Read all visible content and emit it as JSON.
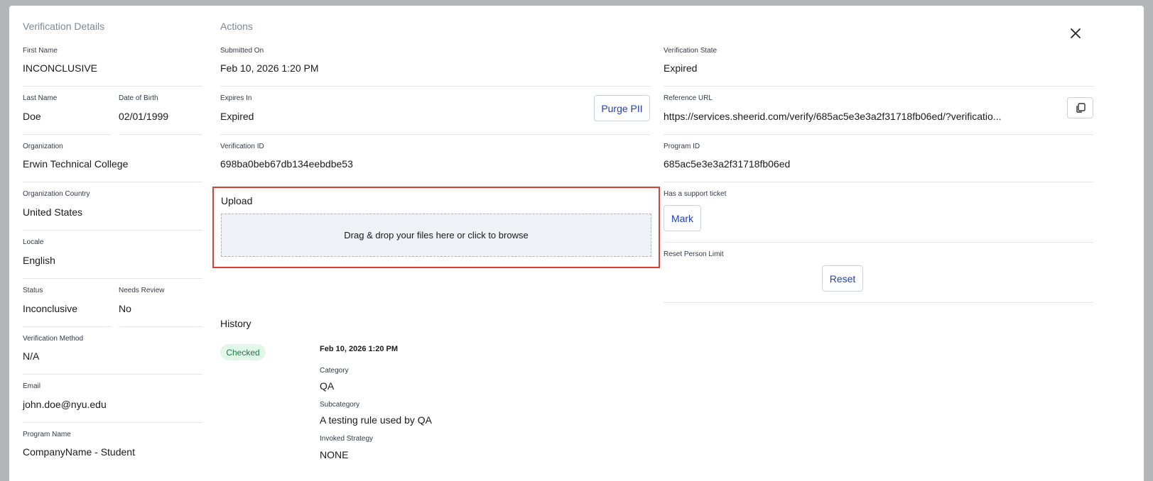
{
  "details": {
    "title": "Verification Details",
    "first_name": {
      "label": "First Name",
      "value": "INCONCLUSIVE"
    },
    "last_name": {
      "label": "Last Name",
      "value": "Doe"
    },
    "dob": {
      "label": "Date of Birth",
      "value": "02/01/1999"
    },
    "organization": {
      "label": "Organization",
      "value": "Erwin Technical College"
    },
    "org_country": {
      "label": "Organization Country",
      "value": "United States"
    },
    "locale": {
      "label": "Locale",
      "value": "English"
    },
    "status": {
      "label": "Status",
      "value": "Inconclusive"
    },
    "needs_review": {
      "label": "Needs Review",
      "value": "No"
    },
    "method": {
      "label": "Verification Method",
      "value": "N/A"
    },
    "email": {
      "label": "Email",
      "value": "john.doe@nyu.edu"
    },
    "program_name": {
      "label": "Program Name",
      "value": "CompanyName - Student"
    }
  },
  "actions": {
    "title": "Actions",
    "submitted_on": {
      "label": "Submitted On",
      "value": "Feb 10, 2026 1:20 PM"
    },
    "expires_in": {
      "label": "Expires In",
      "value": "Expired"
    },
    "purge_button": "Purge PII",
    "verification_id": {
      "label": "Verification ID",
      "value": "698ba0beb67db134eebdbe53"
    },
    "upload": {
      "title": "Upload",
      "dropzone_text": "Drag & drop your files here or click to browse"
    }
  },
  "right": {
    "state": {
      "label": "Verification State",
      "value": "Expired"
    },
    "reference_url": {
      "label": "Reference URL",
      "value": "https://services.sheerid.com/verify/685ac5e3e3a2f31718fb06ed/?verificatio..."
    },
    "program_id": {
      "label": "Program ID",
      "value": "685ac5e3e3a2f31718fb06ed"
    },
    "support_ticket": {
      "label": "Has a support ticket",
      "button": "Mark"
    },
    "reset_limit": {
      "label": "Reset Person Limit",
      "button": "Reset"
    }
  },
  "history": {
    "title": "History",
    "entries": [
      {
        "badge": "Checked",
        "date": "Feb 10, 2026 1:20 PM",
        "category_label": "Category",
        "category": "QA",
        "subcategory_label": "Subcategory",
        "subcategory": "A testing rule used by QA",
        "strategy_label": "Invoked Strategy",
        "strategy": "NONE"
      }
    ]
  },
  "colors": {
    "accent": "#1f3cc9",
    "highlight": "#e33b2e",
    "badge_bg": "#e3f6ea",
    "badge_text": "#1f7a44"
  },
  "icons": {
    "close": "close-icon",
    "copy": "copy-icon"
  }
}
